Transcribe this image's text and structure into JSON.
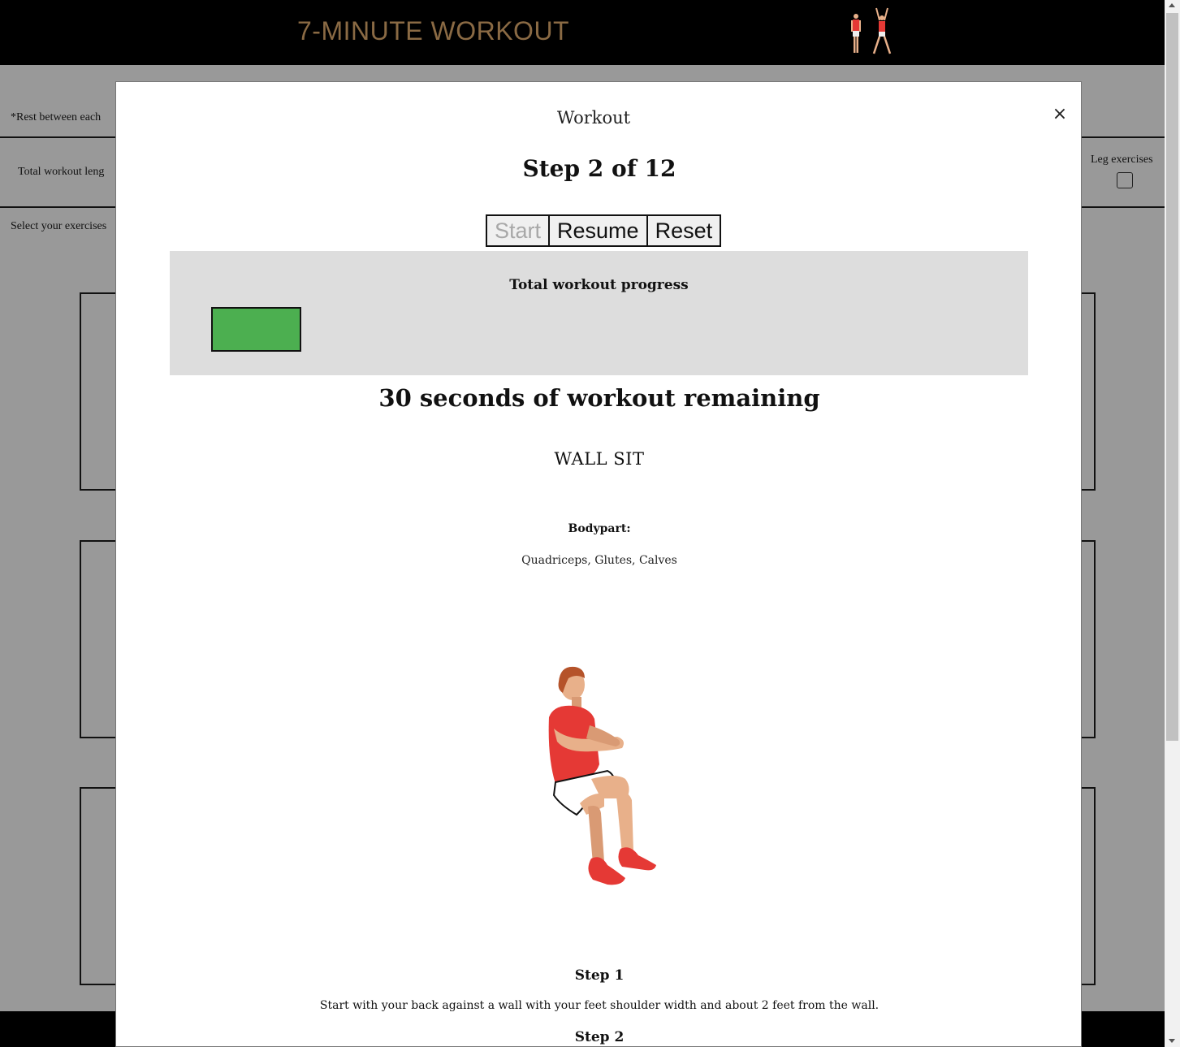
{
  "app": {
    "title": "7-MINUTE WORKOUT"
  },
  "background": {
    "rest_note": "*Rest between each",
    "total_length_label": "Total workout leng",
    "select_label": "Select your exercises",
    "leg_exercises_label": "Leg exercises",
    "leg_exercises_checked": false
  },
  "modal": {
    "title": "Workout",
    "close_label": "×",
    "step_heading": "Step 2 of 12",
    "controls": {
      "start_label": "Start",
      "resume_label": "Resume",
      "reset_label": "Reset"
    },
    "progress": {
      "label": "Total workout progress",
      "fraction": 0.116
    },
    "remaining_text": "30 seconds of workout remaining",
    "exercise": {
      "name": "WALL SIT",
      "bodypart_label": "Bodypart:",
      "bodypart_value": "Quadriceps, Glutes, Calves",
      "illustration_icon": "wall-sit-figure-icon"
    },
    "steps": [
      {
        "title": "Step 1",
        "description": "Start with your back against a wall with your feet shoulder width and about 2 feet from the wall."
      },
      {
        "title": "Step 2",
        "description": ""
      }
    ]
  },
  "colors": {
    "title": "#8a6a44",
    "progress_fill": "#4caf50",
    "shirt": "#e53935",
    "skin": "#e8b08a"
  }
}
